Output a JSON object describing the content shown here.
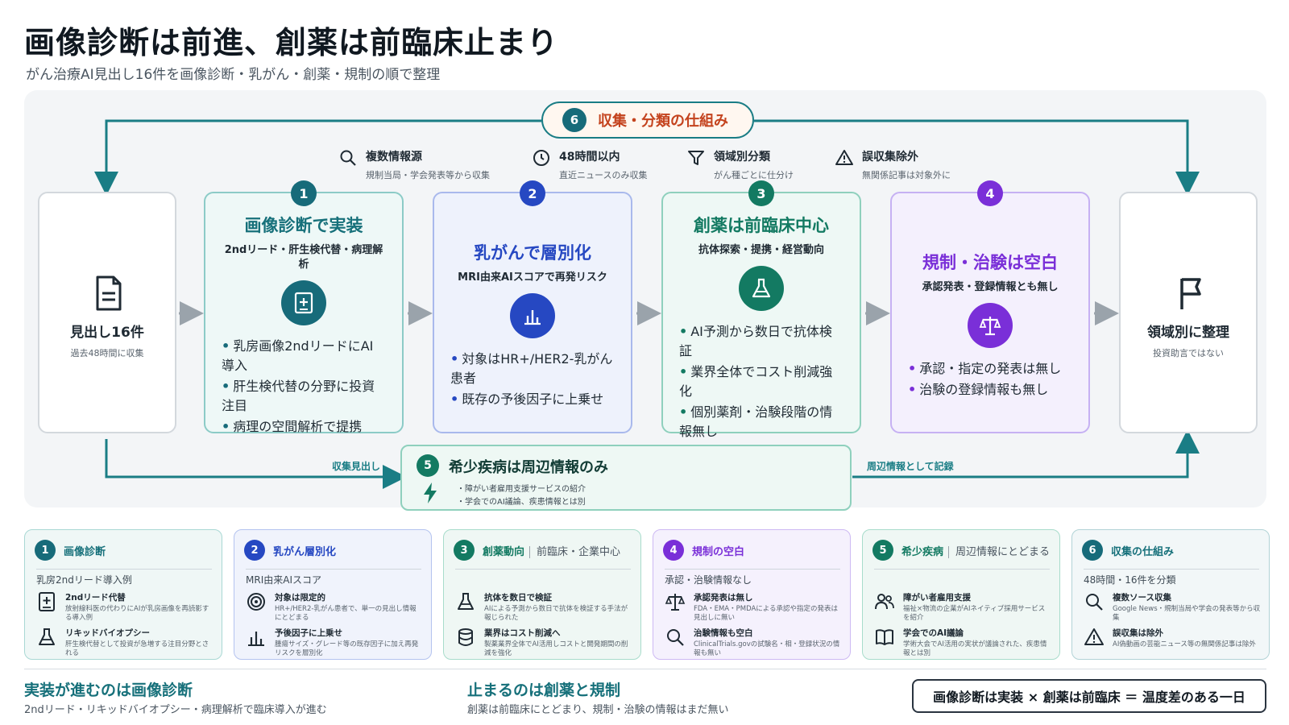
{
  "title": "画像診断は前進、創薬は前臨床止まり",
  "subtitle": "がん治療AI見出し16件を画像診断・乳がん・創薬・規制の順で整理",
  "cycle_pill": {
    "num": "6",
    "label": "収集・分類の仕組み"
  },
  "features": [
    {
      "title": "複数情報源",
      "sub": "規制当局・学会発表等から収集",
      "icon": "search-icon"
    },
    {
      "title": "48時間以内",
      "sub": "直近ニュースのみ収集",
      "icon": "clock-icon"
    },
    {
      "title": "領域別分類",
      "sub": "がん種ごとに仕分け",
      "icon": "filter-icon"
    },
    {
      "title": "誤収集除外",
      "sub": "無関係記事は対象外に",
      "icon": "warning-icon"
    }
  ],
  "start": {
    "title": "見出し16件",
    "sub": "過去48時間に収集",
    "icon": "document-icon"
  },
  "end": {
    "title": "領域別に整理",
    "sub": "投資助言ではない",
    "icon": "flag-icon"
  },
  "steps": [
    {
      "num": "1",
      "title": "画像診断で実装",
      "sub": "2ndリード・肝生検代替・病理解析",
      "icon": "medical-image-icon",
      "bullets": [
        "乳房画像2ndリードにAI導入",
        "肝生検代替の分野に投資注目",
        "病理の空間解析で提携"
      ]
    },
    {
      "num": "2",
      "title": "乳がんで層別化",
      "sub": "MRI由来AIスコアで再発リスク",
      "icon": "bar-chart-icon",
      "bullets": [
        "対象はHR+/HER2-乳がん患者",
        "既存の予後因子に上乗せ"
      ]
    },
    {
      "num": "3",
      "title": "創薬は前臨床中心",
      "sub": "抗体探索・提携・経営動向",
      "icon": "flask-icon",
      "bullets": [
        "AI予測から数日で抗体検証",
        "業界全体でコスト削減強化",
        "個別薬剤・治験段階の情報無し"
      ]
    },
    {
      "num": "4",
      "title": "規制・治験は空白",
      "sub": "承認発表・登録情報とも無し",
      "icon": "scale-icon",
      "bullets": [
        "承認・指定の発表は無し",
        "治験の登録情報も無し"
      ]
    }
  ],
  "rare": {
    "num": "5",
    "title": "希少疾病は周辺情報のみ",
    "items": [
      "障がい者雇用支援サービスの紹介",
      "学会でのAI議論、疾患情報とは別"
    ],
    "icon": "bolt-icon"
  },
  "flow_labels": {
    "left": "収集見出し",
    "right": "周辺情報として記録"
  },
  "cards": [
    {
      "num": "1",
      "title": "画像診断",
      "title2": "",
      "sub": "乳房2ndリード導入例",
      "items": [
        {
          "a": "2ndリード代替",
          "b": "放射線科医の代わりにAIが乳房画像を再読影する導入例",
          "icon": "medical-image-icon"
        },
        {
          "a": "リキッドバイオプシー",
          "b": "肝生検代替として投資が急増する注目分野とされる",
          "icon": "flask-icon"
        }
      ]
    },
    {
      "num": "2",
      "title": "乳がん層別化",
      "title2": "",
      "sub": "MRI由来AIスコア",
      "items": [
        {
          "a": "対象は限定的",
          "b": "HR+/HER2-乳がん患者で、単一の見出し情報にとどまる",
          "icon": "target-icon"
        },
        {
          "a": "予後因子に上乗せ",
          "b": "腫瘍サイズ・グレード等の既存因子に加え再発リスクを層別化",
          "icon": "bar-chart-icon"
        }
      ]
    },
    {
      "num": "3",
      "title": "創薬動向",
      "title2": "前臨床・企業中心",
      "sub": "",
      "items": [
        {
          "a": "抗体を数日で検証",
          "b": "AIによる予測から数日で抗体を検証する手法が報じられた",
          "icon": "flask-icon"
        },
        {
          "a": "業界はコスト削減へ",
          "b": "製薬業界全体でAI活用しコストと開発期間の削減を強化",
          "icon": "database-icon"
        }
      ]
    },
    {
      "num": "4",
      "title": "規制の空白",
      "title2": "",
      "sub": "承認・治験情報なし",
      "items": [
        {
          "a": "承認発表は無し",
          "b": "FDA・EMA・PMDAによる承認や指定の発表は見出しに無い",
          "icon": "scale-icon"
        },
        {
          "a": "治験情報も空白",
          "b": "ClinicalTrials.govの試験名・相・登録状況の情報も無い",
          "icon": "search-icon"
        }
      ]
    },
    {
      "num": "5",
      "title": "希少疾病",
      "title2": "周辺情報にとどまる",
      "sub": "",
      "items": [
        {
          "a": "障がい者雇用支援",
          "b": "福祉×物流の企業がAIネイティブ採用サービスを紹介",
          "icon": "people-icon"
        },
        {
          "a": "学会でのAI議論",
          "b": "学術大会でAI活用の実状が議論された、疾患情報とは別",
          "icon": "book-icon"
        }
      ]
    },
    {
      "num": "6",
      "title": "収集の仕組み",
      "title2": "",
      "sub": "48時間・16件を分類",
      "items": [
        {
          "a": "複数ソース収集",
          "b": "Google News・規制当局や学会の発表等から収集",
          "icon": "search-icon"
        },
        {
          "a": "誤収集は除外",
          "b": "AI偽動画の芸能ニュース等の無関係記事は除外",
          "icon": "warning-icon"
        }
      ]
    }
  ],
  "footer": {
    "left_title": "実装が進むのは画像診断",
    "left_sub": "2ndリード・リキッドバイオプシー・病理解析で臨床導入が進む",
    "mid_title": "止まるのは創薬と規制",
    "mid_sub": "創薬は前臨床にとどまり、規制・治験の情報はまだ無い",
    "conclusion": "画像診断は実装 × 創薬は前臨床 ＝ 温度差のある一日"
  },
  "colors": {
    "teal": "#176b7a",
    "blue": "#2648c2",
    "green": "#137a62",
    "purple": "#7a2fd8",
    "orange": "#c4431e"
  }
}
